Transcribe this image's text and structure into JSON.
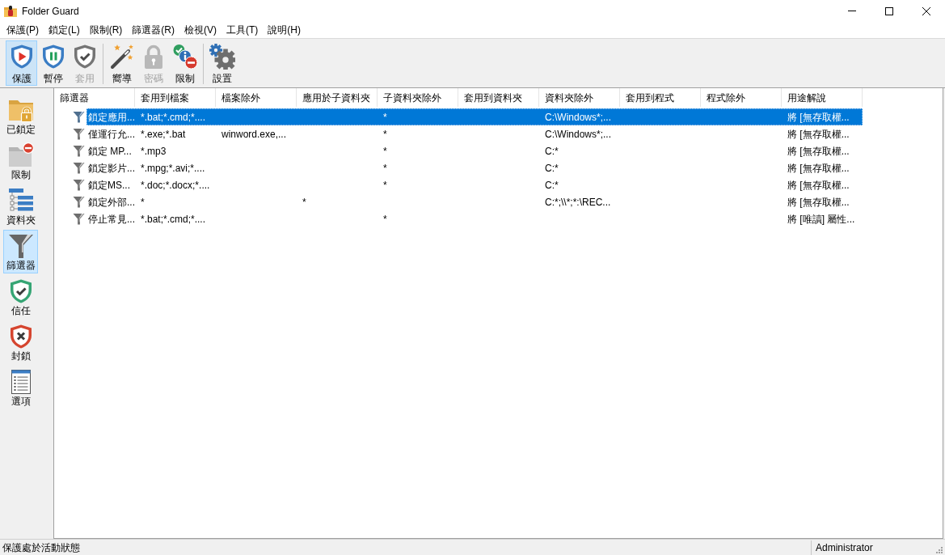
{
  "window": {
    "title": "Folder Guard"
  },
  "menu": [
    "保護(P)",
    "鎖定(L)",
    "限制(R)",
    "篩選器(R)",
    "檢視(V)",
    "工具(T)",
    "說明(H)"
  ],
  "toolbar_groups": [
    {
      "buttons": [
        {
          "kind": "protect",
          "label": "保護",
          "pressed": true,
          "disabled": false
        },
        {
          "kind": "pause",
          "label": "暫停",
          "pressed": false,
          "disabled": false
        },
        {
          "kind": "apply",
          "label": "套用",
          "pressed": false,
          "disabled": true
        }
      ]
    },
    {
      "buttons": [
        {
          "kind": "wizard",
          "label": "嚮導",
          "pressed": false,
          "disabled": false
        },
        {
          "kind": "password",
          "label": "密碼",
          "pressed": false,
          "disabled": true
        },
        {
          "kind": "restrict",
          "label": "限制",
          "pressed": false,
          "disabled": false
        }
      ]
    },
    {
      "buttons": [
        {
          "kind": "settings",
          "label": "設置",
          "pressed": false,
          "disabled": false
        }
      ]
    }
  ],
  "sidebar": {
    "items": [
      {
        "kind": "locked",
        "label": "已鎖定",
        "selected": false
      },
      {
        "kind": "restricted",
        "label": "限制",
        "selected": false
      },
      {
        "kind": "folders",
        "label": "資料夾",
        "selected": false
      },
      {
        "kind": "filters",
        "label": "篩選器",
        "selected": true
      },
      {
        "kind": "trust",
        "label": "信任",
        "selected": false
      },
      {
        "kind": "block",
        "label": "封鎖",
        "selected": false
      },
      {
        "kind": "options",
        "label": "選項",
        "selected": false
      }
    ]
  },
  "table": {
    "columns": [
      "篩選器",
      "套用到檔案",
      "檔案除外",
      "應用於子資料夾",
      "子資料夾除外",
      "套用到資料夾",
      "資料夾除外",
      "套用到程式",
      "程式除外",
      "用途解說"
    ],
    "rows": [
      {
        "selected": true,
        "filter": "鎖定應用...",
        "apply_to_files": "*.bat;*.cmd;*....",
        "exclude_subfolders": "*",
        "exclude_folders": "C:\\Windows*;...",
        "description": "將 [無存取權..."
      },
      {
        "selected": false,
        "filter": "僅運行允...",
        "apply_to_files": "*.exe;*.bat",
        "exclude_files": "winword.exe,...",
        "exclude_subfolders": "*",
        "exclude_folders": "C:\\Windows*;...",
        "description": "將 [無存取權..."
      },
      {
        "selected": false,
        "filter": "鎖定 MP...",
        "apply_to_files": "*.mp3",
        "exclude_subfolders": "*",
        "exclude_folders": "C:*",
        "description": "將 [無存取權..."
      },
      {
        "selected": false,
        "filter": "鎖定影片...",
        "apply_to_files": "*.mpg;*.avi;*....",
        "exclude_subfolders": "*",
        "exclude_folders": "C:*",
        "description": "將 [無存取權..."
      },
      {
        "selected": false,
        "filter": "鎖定MS...",
        "apply_to_files": "*.doc;*.docx;*....",
        "exclude_subfolders": "*",
        "exclude_folders": "C:*",
        "description": "將 [無存取權..."
      },
      {
        "selected": false,
        "filter": "鎖定外部...",
        "apply_to_files": "*",
        "apply_to_subfolders": "*",
        "exclude_folders": "C:*;\\\\*;*:\\REC...",
        "description": "將 [無存取權..."
      },
      {
        "selected": false,
        "filter": "停止常見...",
        "apply_to_files": "*.bat;*.cmd;*....",
        "exclude_subfolders": "*",
        "description": "將 [唯讀] 屬性..."
      }
    ]
  },
  "status_bar": {
    "message": "保護處於活動狀態",
    "user": "Administrator"
  }
}
